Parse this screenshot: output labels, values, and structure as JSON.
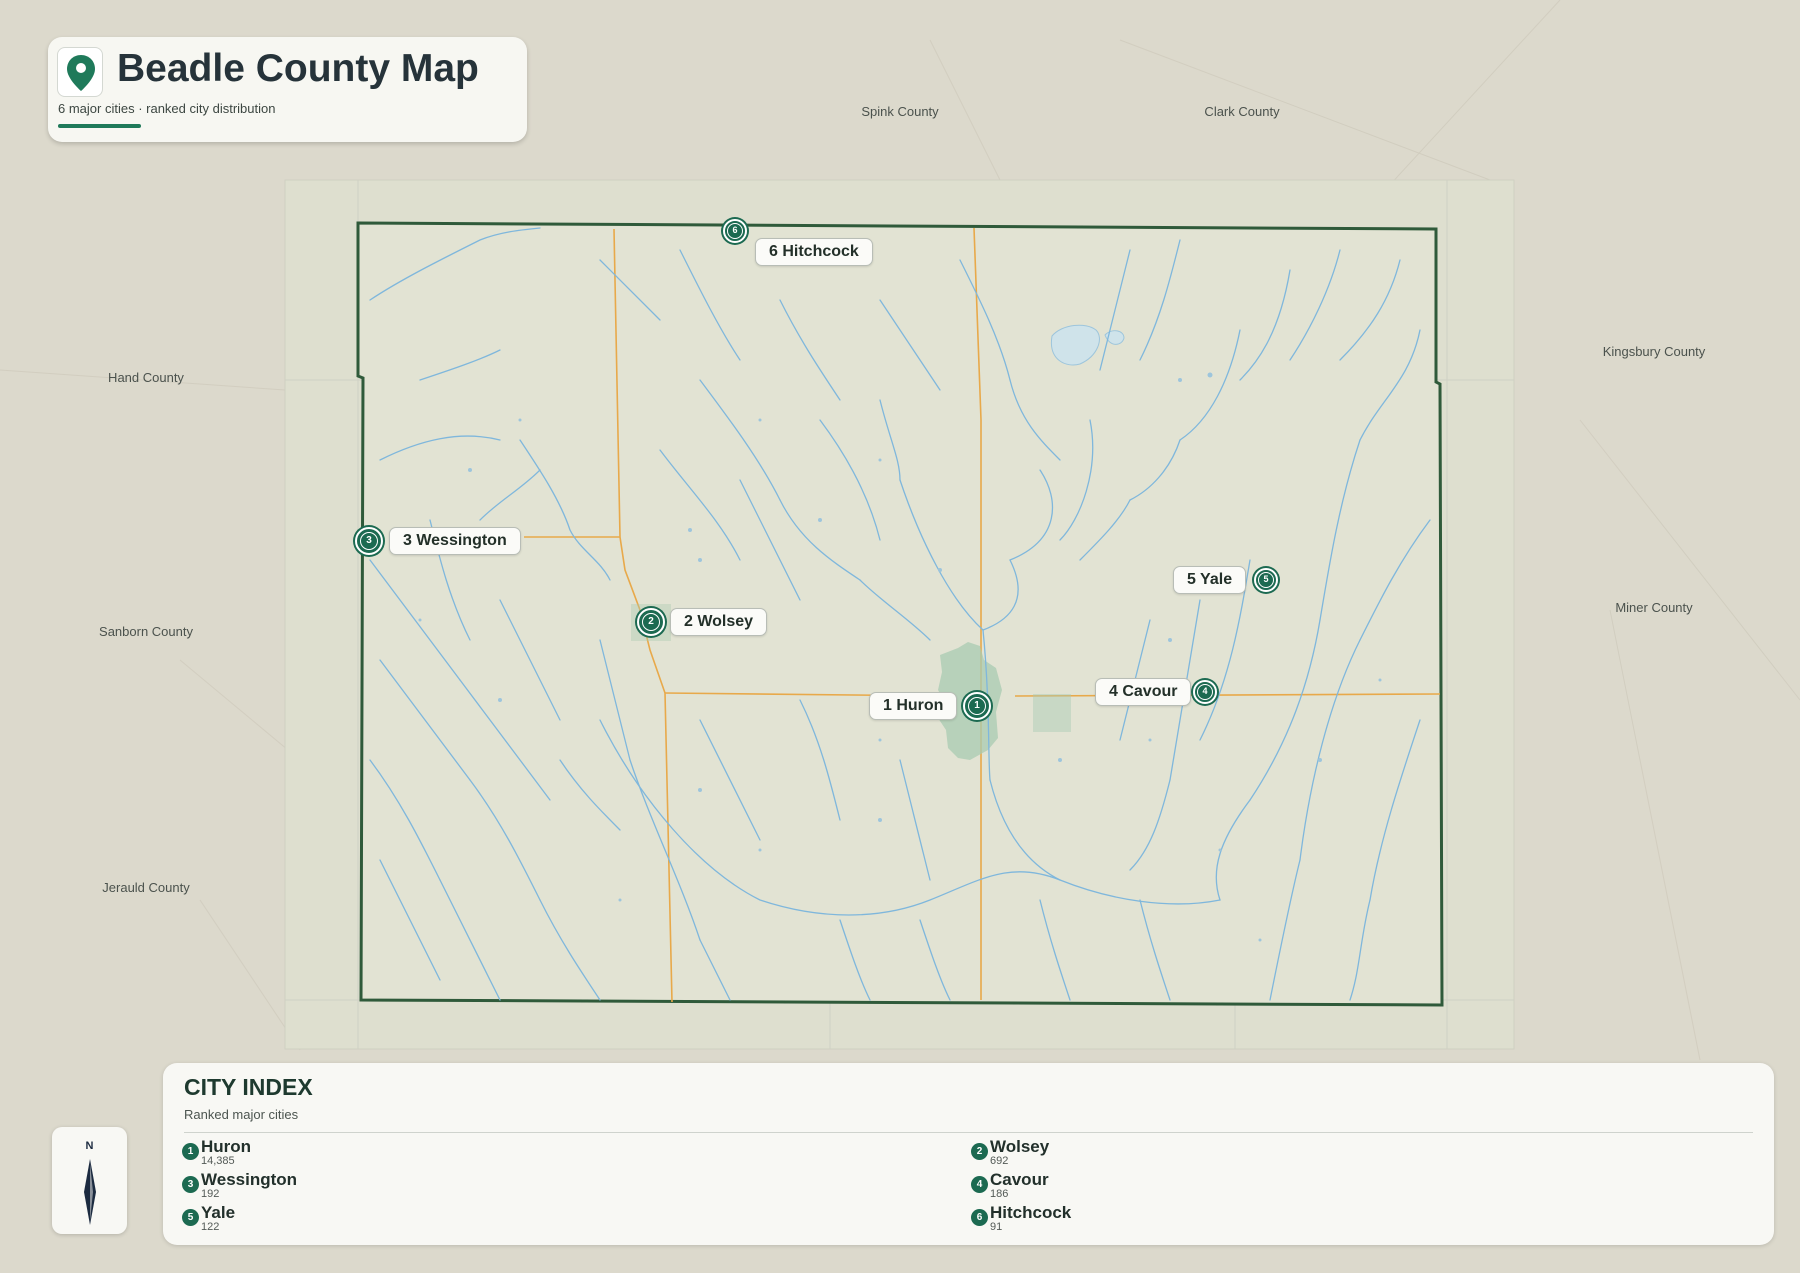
{
  "header": {
    "title": "Beadle County Map",
    "subtitle": "6 major cities · ranked city distribution"
  },
  "neighbors": {
    "spink": "Spink County",
    "clark": "Clark County",
    "hand": "Hand County",
    "kingsbury": "Kingsbury County",
    "sanborn": "Sanborn County",
    "miner": "Miner County",
    "jerauld": "Jerauld County"
  },
  "cities": [
    {
      "rank": "1",
      "name": "Huron",
      "population": "14,385",
      "label": "1 Huron"
    },
    {
      "rank": "2",
      "name": "Wolsey",
      "population": "692",
      "label": "2 Wolsey"
    },
    {
      "rank": "3",
      "name": "Wessington",
      "population": "192",
      "label": "3 Wessington"
    },
    {
      "rank": "4",
      "name": "Cavour",
      "population": "186",
      "label": "4 Cavour"
    },
    {
      "rank": "5",
      "name": "Yale",
      "population": "122",
      "label": "5 Yale"
    },
    {
      "rank": "6",
      "name": "Hitchcock",
      "population": "91",
      "label": "6 Hitchcock"
    }
  ],
  "compass": {
    "north": "N"
  },
  "index": {
    "title": "CITY INDEX",
    "subtitle": "Ranked major cities"
  },
  "colors": {
    "county_border": "#2f5a3a",
    "county_fill": "#e0e2d1",
    "water": "#7fb7dc",
    "roads": "#e8a94a",
    "marker": "#1c6a51",
    "urban": "#a9cbb2"
  },
  "icons": {
    "title": "map-pin-icon",
    "compass": "compass-needle-icon"
  }
}
